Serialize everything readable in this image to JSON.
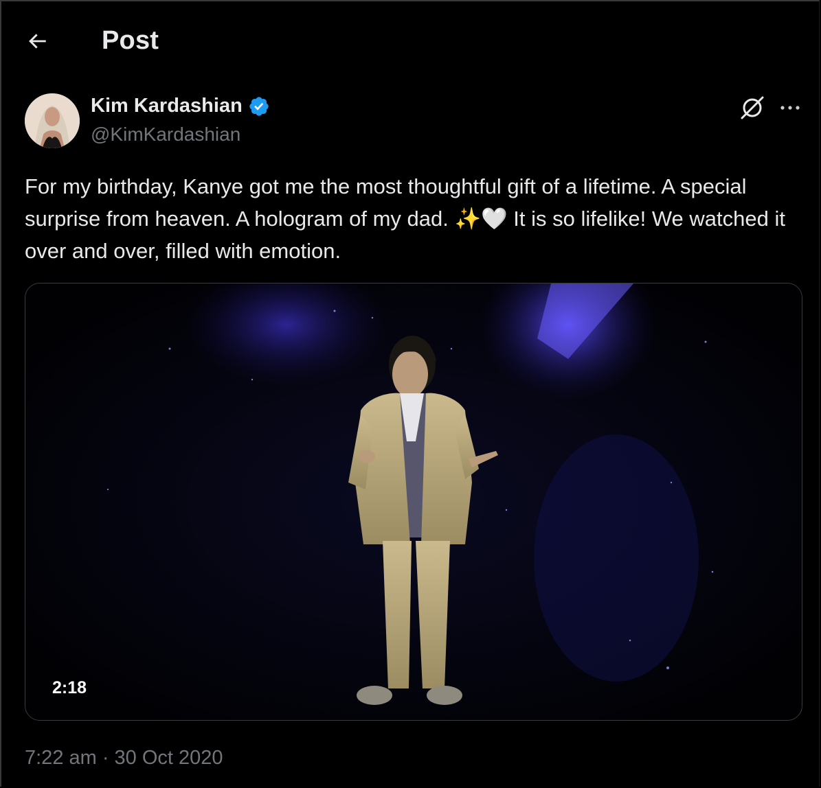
{
  "header": {
    "title": "Post"
  },
  "author": {
    "name": "Kim Kardashian",
    "handle": "@KimKardashian",
    "verified": true
  },
  "post": {
    "text": "For my birthday, Kanye got me the most thoughtful gift of a lifetime. A special surprise from heaven. A hologram of my dad. ✨🤍 It is so lifelike! We watched it over and over, filled with emotion.",
    "video_duration": "2:18",
    "timestamp": "7:22 am · 30 Oct 2020"
  },
  "icons": {
    "back": "arrow-left-icon",
    "verified": "verified-badge-icon",
    "grok": "grok-icon",
    "more": "more-icon"
  },
  "colors": {
    "background": "#000000",
    "text": "#e7e9ea",
    "secondary_text": "#71767b",
    "verified_blue": "#1d9bf0"
  }
}
